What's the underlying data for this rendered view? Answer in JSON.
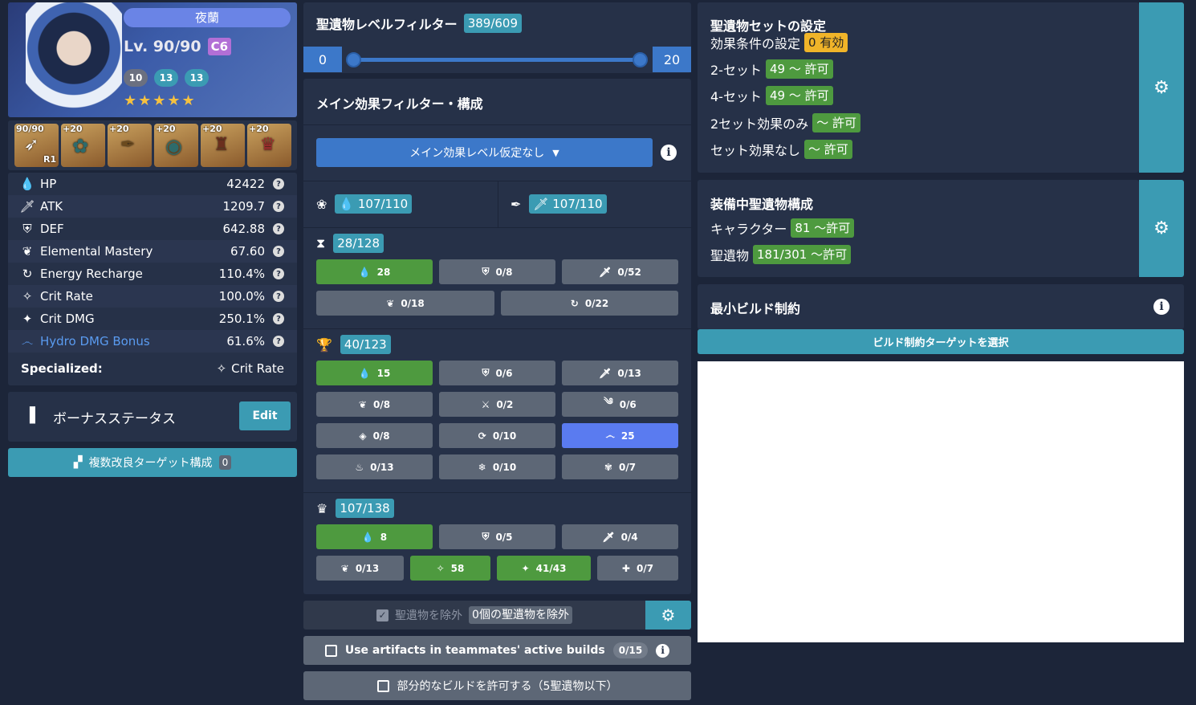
{
  "character": {
    "name": "夜蘭",
    "level": "Lv. 90/90",
    "constellation": "C6",
    "talents": [
      "10",
      "13",
      "13"
    ],
    "stars": 5
  },
  "equipment": [
    {
      "level": "90/90",
      "badge": "R1",
      "icon": "bow-icon"
    },
    {
      "level": "+20",
      "icon": "flower-artifact-icon"
    },
    {
      "level": "+20",
      "icon": "plume-artifact-icon"
    },
    {
      "level": "+20",
      "icon": "sands-artifact-icon"
    },
    {
      "level": "+20",
      "icon": "goblet-artifact-icon"
    },
    {
      "level": "+20",
      "icon": "circlet-artifact-icon"
    }
  ],
  "stats": [
    {
      "name": "HP",
      "value": "42422",
      "icon": "hp-icon"
    },
    {
      "name": "ATK",
      "value": "1209.7",
      "icon": "atk-icon"
    },
    {
      "name": "DEF",
      "value": "642.88",
      "icon": "def-icon"
    },
    {
      "name": "Elemental Mastery",
      "value": "67.60",
      "icon": "em-icon"
    },
    {
      "name": "Energy Recharge",
      "value": "110.4%",
      "icon": "er-icon"
    },
    {
      "name": "Crit Rate",
      "value": "100.0%",
      "icon": "crit-rate-icon"
    },
    {
      "name": "Crit DMG",
      "value": "250.1%",
      "icon": "crit-dmg-icon"
    },
    {
      "name": "Hydro DMG Bonus",
      "value": "61.6%",
      "icon": "hydro-icon",
      "color": "#5a9bf0"
    }
  ],
  "specialized": {
    "label": "Specialized:",
    "value": "Crit Rate"
  },
  "bonus": {
    "label": "ボーナスステータス",
    "edit": "Edit"
  },
  "multi_target": {
    "label": "複数改良ターゲット構成",
    "count": "0"
  },
  "level_filter": {
    "title": "聖遺物レベルフィルター",
    "count": "389/609",
    "min": "0",
    "max": "20"
  },
  "main_filter": {
    "title": "メイン効果フィルター・構成",
    "dropdown": "メイン効果レベル仮定なし",
    "flower": "107/110",
    "plume": "107/110",
    "sands": {
      "count": "28/128",
      "row1": [
        {
          "v": "28",
          "on": true,
          "icon": "hp"
        },
        {
          "v": "0/8",
          "icon": "def"
        },
        {
          "v": "0/52",
          "icon": "atk"
        }
      ],
      "row2": [
        {
          "v": "0/18",
          "icon": "em"
        },
        {
          "v": "0/22",
          "icon": "er"
        }
      ]
    },
    "goblet": {
      "count": "40/123",
      "rows": [
        [
          {
            "v": "15",
            "on": true,
            "icon": "hp"
          },
          {
            "v": "0/6",
            "icon": "def"
          },
          {
            "v": "0/13",
            "icon": "atk"
          }
        ],
        [
          {
            "v": "0/8",
            "icon": "em"
          },
          {
            "v": "0/2",
            "icon": "phys"
          },
          {
            "v": "0/6",
            "icon": "anemo"
          }
        ],
        [
          {
            "v": "0/8",
            "icon": "geo"
          },
          {
            "v": "0/10",
            "icon": "electro"
          },
          {
            "v": "25",
            "blue": true,
            "icon": "hydro"
          }
        ],
        [
          {
            "v": "0/13",
            "icon": "pyro"
          },
          {
            "v": "0/10",
            "icon": "cryo"
          },
          {
            "v": "0/7",
            "icon": "dendro"
          }
        ]
      ]
    },
    "circlet": {
      "count": "107/138",
      "row1": [
        {
          "v": "8",
          "on": true,
          "icon": "hp"
        },
        {
          "v": "0/5",
          "icon": "def"
        },
        {
          "v": "0/4",
          "icon": "atk"
        }
      ],
      "row2": [
        {
          "v": "0/13",
          "icon": "em"
        },
        {
          "v": "58",
          "on": true,
          "icon": "cr"
        },
        {
          "v": "41/43",
          "on": true,
          "icon": "cd"
        },
        {
          "v": "0/7",
          "icon": "heal"
        }
      ]
    }
  },
  "exclude": {
    "label": "聖遺物を除外",
    "count": "0個の聖遺物を除外"
  },
  "teammates": {
    "label": "Use artifacts in teammates' active builds",
    "count": "0/15"
  },
  "partial": {
    "label": "部分的なビルドを許可する（5聖遺物以下）"
  },
  "set_config": {
    "title": "聖遺物セットの設定",
    "cond_label": "効果条件の設定",
    "cond_value": "0 有効",
    "two_label": "2-セット",
    "two_value": "49 ～ 許可",
    "four_label": "4-セット",
    "four_value": "49 ～ 許可",
    "two_only_label": "2セット効果のみ",
    "two_only_value": "～ 許可",
    "none_label": "セット効果なし",
    "none_value": "～ 許可"
  },
  "equipped": {
    "title": "装備中聖遺物構成",
    "char_label": "キャラクター",
    "char_value": "81 ～許可",
    "art_label": "聖遺物",
    "art_value": "181/301 ～許可"
  },
  "min_build": {
    "title": "最小ビルド制約",
    "button": "ビルド制約ターゲットを選択"
  }
}
